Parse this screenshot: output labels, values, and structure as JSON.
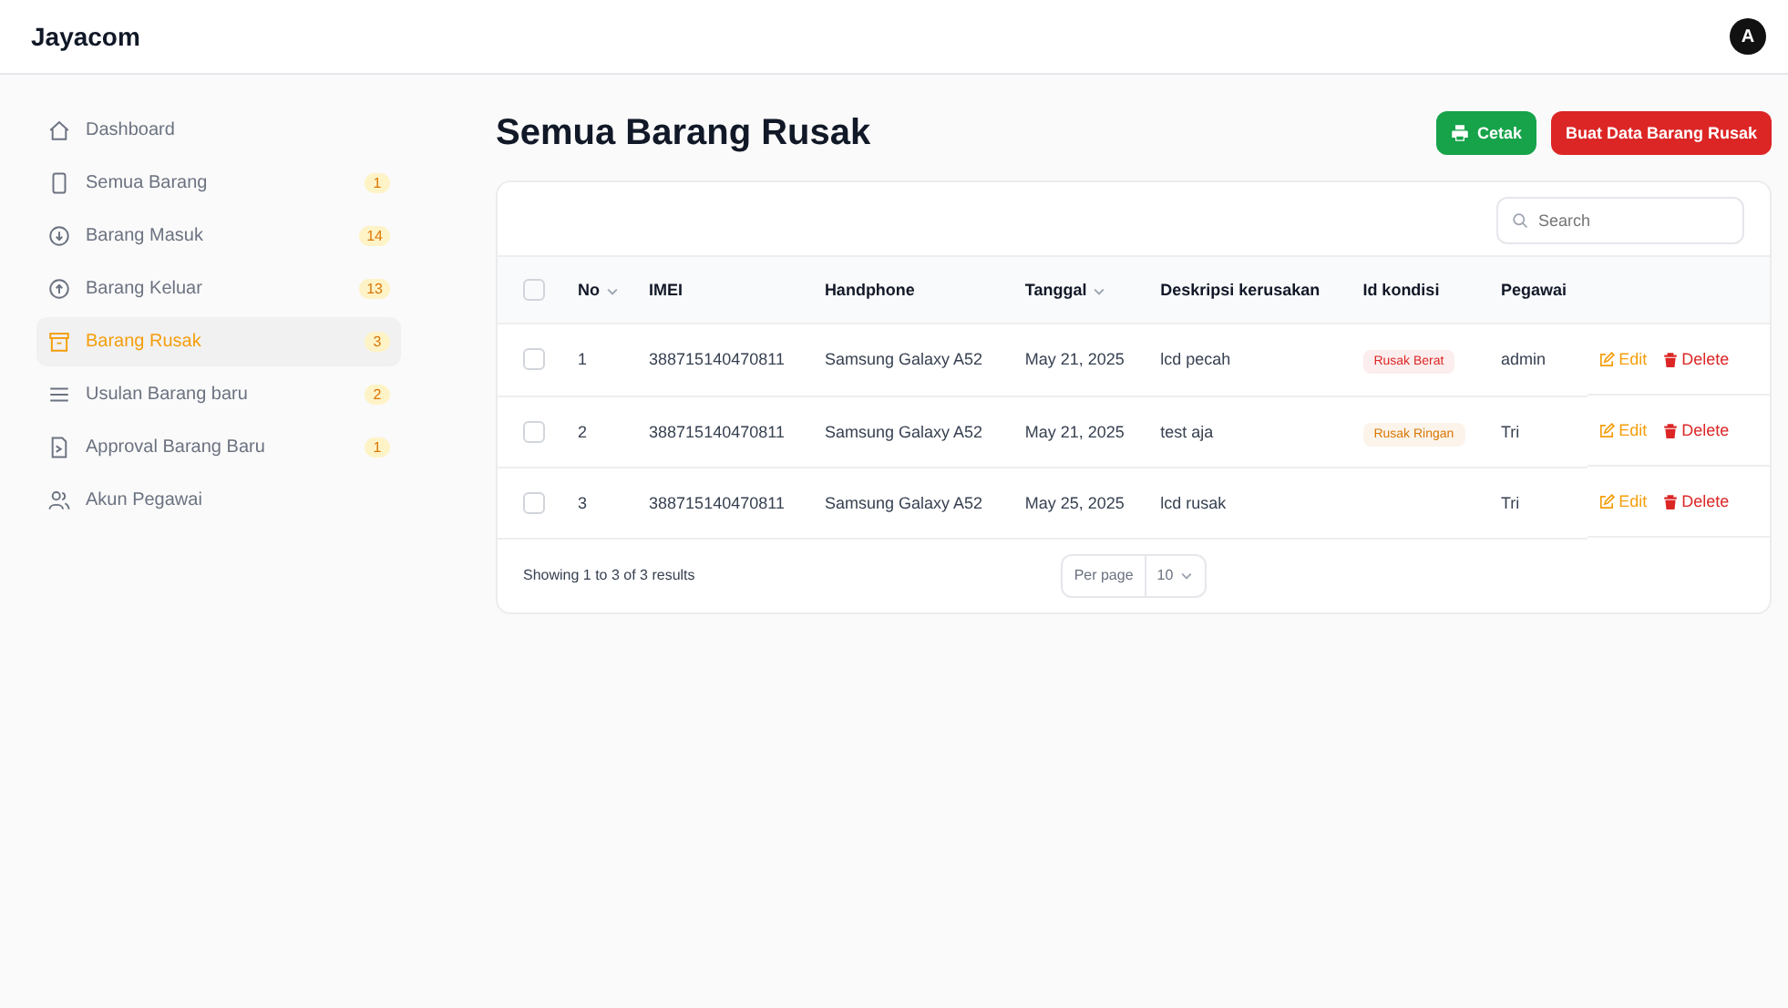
{
  "brand": "Jayacom",
  "avatar": "A",
  "sidebar": {
    "items": [
      {
        "label": "Dashboard",
        "kind": "home",
        "selected": false
      },
      {
        "label": "Semua Barang",
        "kind": "phone",
        "badge": "1",
        "selected": false
      },
      {
        "label": "Barang Masuk",
        "kind": "in",
        "badge": "14",
        "selected": false
      },
      {
        "label": "Barang Keluar",
        "kind": "out",
        "badge": "13",
        "selected": false
      },
      {
        "label": "Barang Rusak",
        "kind": "archive",
        "badge": "3",
        "selected": true
      },
      {
        "label": "Usulan Barang baru",
        "kind": "list",
        "badge": "2",
        "selected": false
      },
      {
        "label": "Approval Barang Baru",
        "kind": "doc",
        "badge": "1",
        "selected": false
      },
      {
        "label": "Akun Pegawai",
        "kind": "users",
        "selected": false
      }
    ]
  },
  "page": {
    "title": "Semua Barang Rusak",
    "buttons": [
      {
        "label": "Cetak",
        "kind": "print"
      },
      {
        "label": "Buat Data Barang Rusak",
        "kind": "create"
      }
    ]
  },
  "table": {
    "search": {
      "placeholder": "Search"
    },
    "columns": [
      {
        "label": "No",
        "sortable": true
      },
      {
        "label": "IMEI",
        "sortable": false
      },
      {
        "label": "Handphone",
        "sortable": false
      },
      {
        "label": "Tanggal",
        "sortable": true
      },
      {
        "label": "Deskripsi kerusakan",
        "sortable": false
      },
      {
        "label": "Id kondisi",
        "sortable": false
      },
      {
        "label": "Pegawai",
        "sortable": false
      }
    ],
    "header_checked": false,
    "rows": [
      {
        "checked": false,
        "no": "1",
        "imei": "388715140470811",
        "handphone": "Samsung Galaxy A52",
        "tanggal": "May 21, 2025",
        "deskripsi": "lcd pecah",
        "kondisi": {
          "label": "Rusak Berat",
          "color": "#dc2626"
        },
        "pegawai": "admin",
        "actions": [
          "Edit",
          "Delete"
        ]
      },
      {
        "checked": false,
        "no": "2",
        "imei": "388715140470811",
        "handphone": "Samsung Galaxy A52",
        "tanggal": "May 21, 2025",
        "deskripsi": "test aja",
        "kondisi": {
          "label": "Rusak Ringan",
          "color": "#d97706"
        },
        "pegawai": "Tri",
        "actions": [
          "Edit",
          "Delete"
        ]
      },
      {
        "checked": false,
        "no": "3",
        "imei": "388715140470811",
        "handphone": "Samsung Galaxy A52",
        "tanggal": "May 25, 2025",
        "deskripsi": "lcd rusak",
        "pegawai": "Tri",
        "actions": [
          "Edit",
          "Delete"
        ]
      }
    ],
    "footer": {
      "summary": "Showing 1 to 3 of 3 results",
      "per_page_label": "Per page",
      "per_page": "10"
    }
  }
}
